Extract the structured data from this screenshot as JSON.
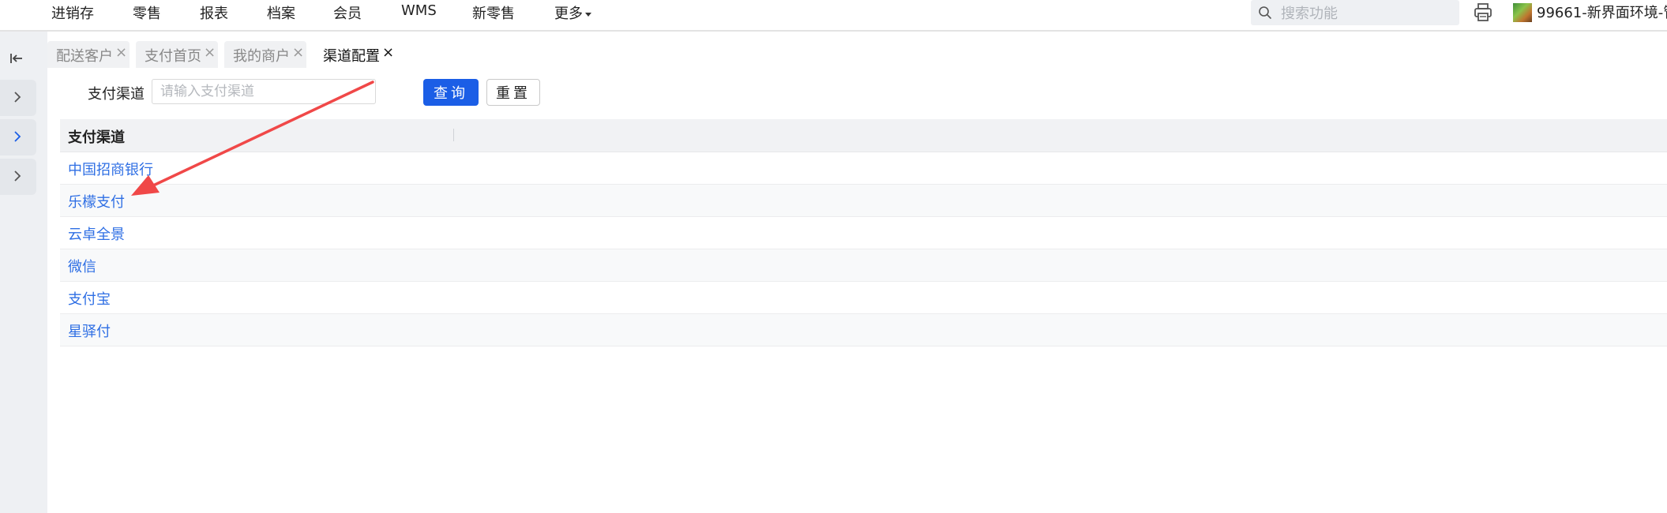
{
  "topnav": {
    "menu": [
      "进销存",
      "零售",
      "报表",
      "档案",
      "会员",
      "WMS",
      "新零售",
      "更多"
    ],
    "search_placeholder": "搜索功能",
    "account": "99661-新界面环境-管"
  },
  "tabs": [
    {
      "label": "配送客户",
      "active": false
    },
    {
      "label": "支付首页",
      "active": false
    },
    {
      "label": "我的商户",
      "active": false
    },
    {
      "label": "渠道配置",
      "active": true
    }
  ],
  "filter": {
    "label": "支付渠道",
    "placeholder": "请输入支付渠道",
    "value": "",
    "query_button": "查询",
    "reset_button": "重置"
  },
  "table": {
    "header": "支付渠道",
    "rows": [
      "中国招商银行",
      "乐檬支付",
      "云卓全景",
      "微信",
      "支付宝",
      "星驿付"
    ]
  },
  "colors": {
    "primary": "#1b5ee6",
    "link": "#2f6fe4",
    "annotation": "#f04848"
  }
}
